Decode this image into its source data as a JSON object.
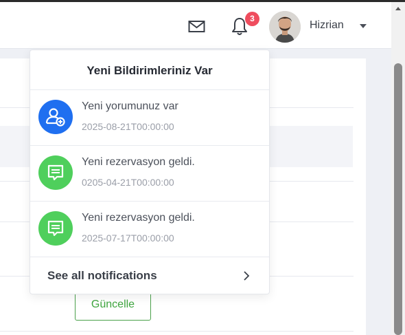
{
  "header": {
    "badge_count": "3",
    "user_name": "Hizrian"
  },
  "dropdown": {
    "title": "Yeni Bildirimleriniz Var",
    "notifications": [
      {
        "text": "Yeni yorumunuz var",
        "time": "2025-08-21T00:00:00",
        "icon": "user-plus-icon",
        "color": "#1f6ff0"
      },
      {
        "text": "Yeni rezervasyon geldi.",
        "time": "0205-04-21T00:00:00",
        "icon": "comment-icon",
        "color": "#4fcf5c"
      },
      {
        "text": "Yeni rezervasyon geldi.",
        "time": "2025-07-17T00:00:00",
        "icon": "comment-icon",
        "color": "#4fcf5c"
      }
    ],
    "see_all_label": "See all notifications"
  },
  "content": {
    "update_button_label": "Güncelle"
  }
}
